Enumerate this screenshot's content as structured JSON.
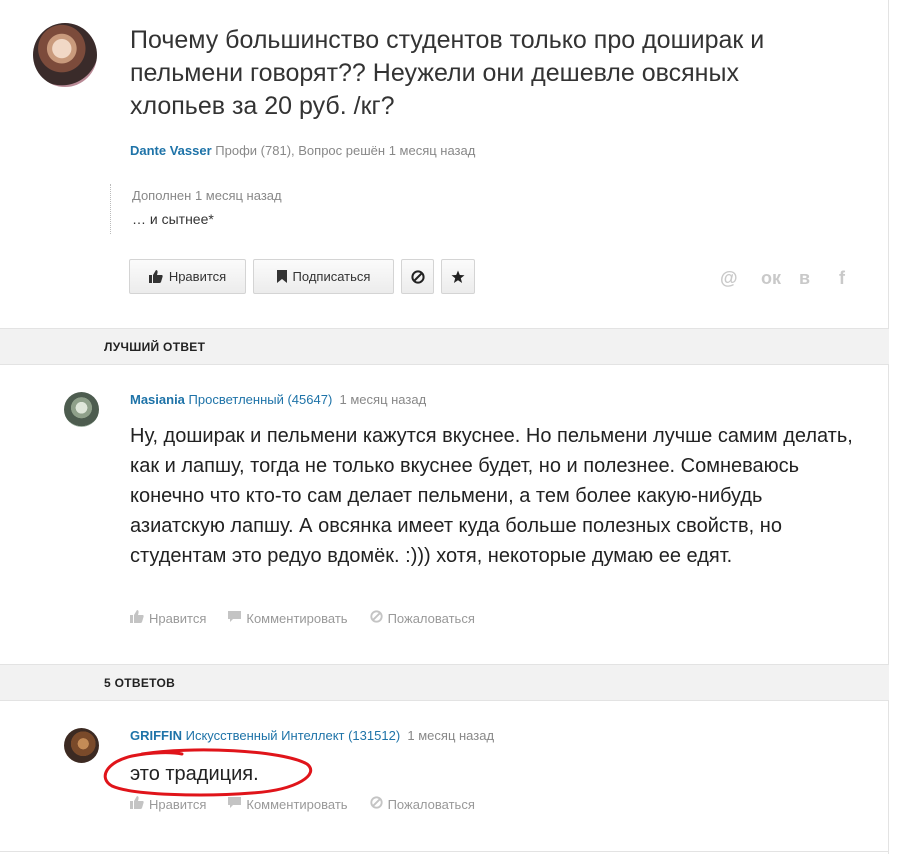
{
  "question": {
    "title": "Почему большинство студентов только про доширак и пельмени говорят?? Неужели они дешевле овсяных хлопьев за 20 руб. /кг?",
    "author": "Dante Vasser",
    "rank": "Профи (781),",
    "status": "Вопрос решён 1 месяц назад",
    "addendum_label": "Дополнен 1 месяц назад",
    "addendum_text": "… и сытнее*"
  },
  "toolbar": {
    "like_label": "Нравится",
    "subscribe_label": "Подписаться"
  },
  "share": {
    "mail": "@",
    "ok": "ок",
    "vk": "в",
    "fb": "f"
  },
  "best_answer": {
    "section_title": "ЛУЧШИЙ ОТВЕТ",
    "author": "Masiania",
    "rank": "Просветленный (45647)",
    "time": "1 месяц назад",
    "text": "Ну, доширак и пельмени кажутся вкуснее. Но пельмени лучше самим делать, как и лапшу, тогда не только вкуснее будет, но и полезнее. Сомневаюсь конечно что кто-то сам делает пельмени, а тем более какую-нибудь азиатскую лапшу. А овсянка имеет куда больше полезных свойств, но студентам это редуо вдомёк. :))) хотя, некоторые думаю ее едят."
  },
  "answers": {
    "section_title": "5 ОТВЕТОВ",
    "items": [
      {
        "author": "GRIFFIN",
        "rank": "Искусственный Интеллект (131512)",
        "time": "1 месяц назад",
        "text": "это традиция."
      }
    ]
  },
  "actions": {
    "like": "Нравится",
    "comment": "Комментировать",
    "report": "Пожаловаться"
  },
  "colors": {
    "link": "#1e73a8",
    "annotation": "#e0141a"
  }
}
